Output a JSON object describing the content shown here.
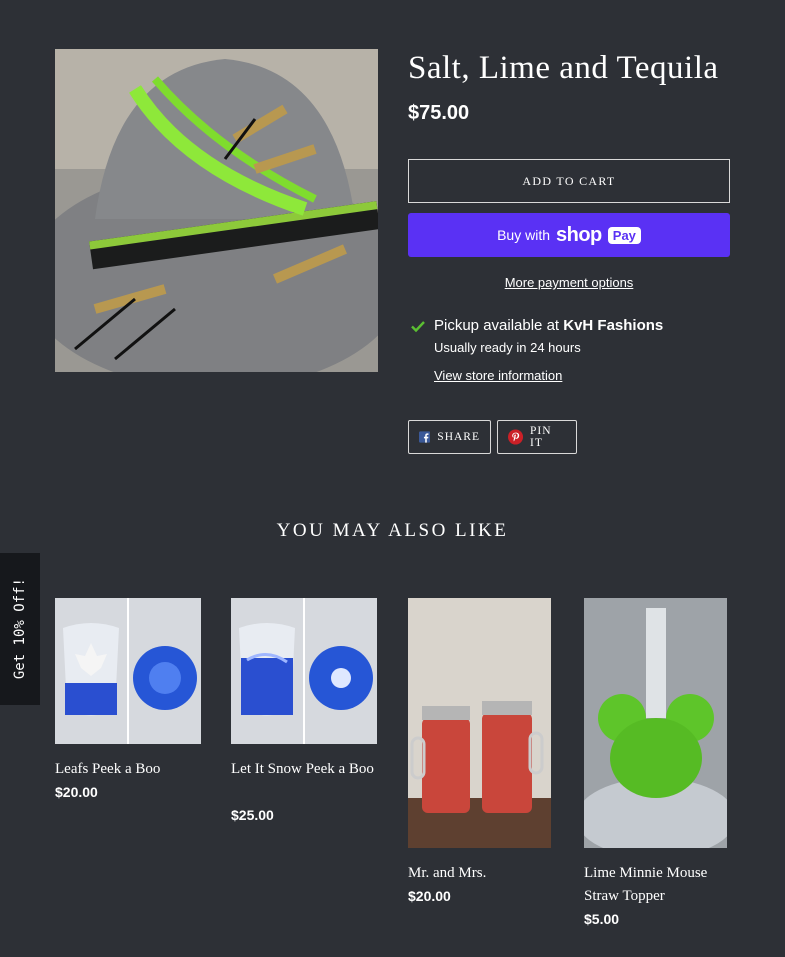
{
  "product": {
    "title": "Salt, Lime and Tequila",
    "price": "$75.00",
    "image_icon": "felt-hat-with-lime-feather"
  },
  "buttons": {
    "add_to_cart": "Add to cart",
    "buy_with": "Buy with",
    "shop_logo": "shop",
    "pay_badge": "Pay",
    "more_payment": "More payment options"
  },
  "pickup": {
    "prefix": "Pickup available at ",
    "store": "KvH Fashions",
    "ready": "Usually ready in 24 hours",
    "store_link": "View store information"
  },
  "social": {
    "share": "SHARE",
    "pin": "PIN IT"
  },
  "related": {
    "heading": "YOU MAY ALSO LIKE",
    "items": [
      {
        "name": "Leafs Peek a Boo",
        "price": "$20.00"
      },
      {
        "name": "Let It Snow Peek a Boo",
        "price": "$25.00"
      },
      {
        "name": "Mr. and Mrs.",
        "price": "$20.00"
      },
      {
        "name": "Lime Minnie Mouse Straw Topper",
        "price": "$5.00"
      }
    ]
  },
  "promo_tab": "Get 10% Off!",
  "colors": {
    "background": "#2d3036",
    "shop_pay": "#5a31f4",
    "check": "#5bbf32"
  }
}
